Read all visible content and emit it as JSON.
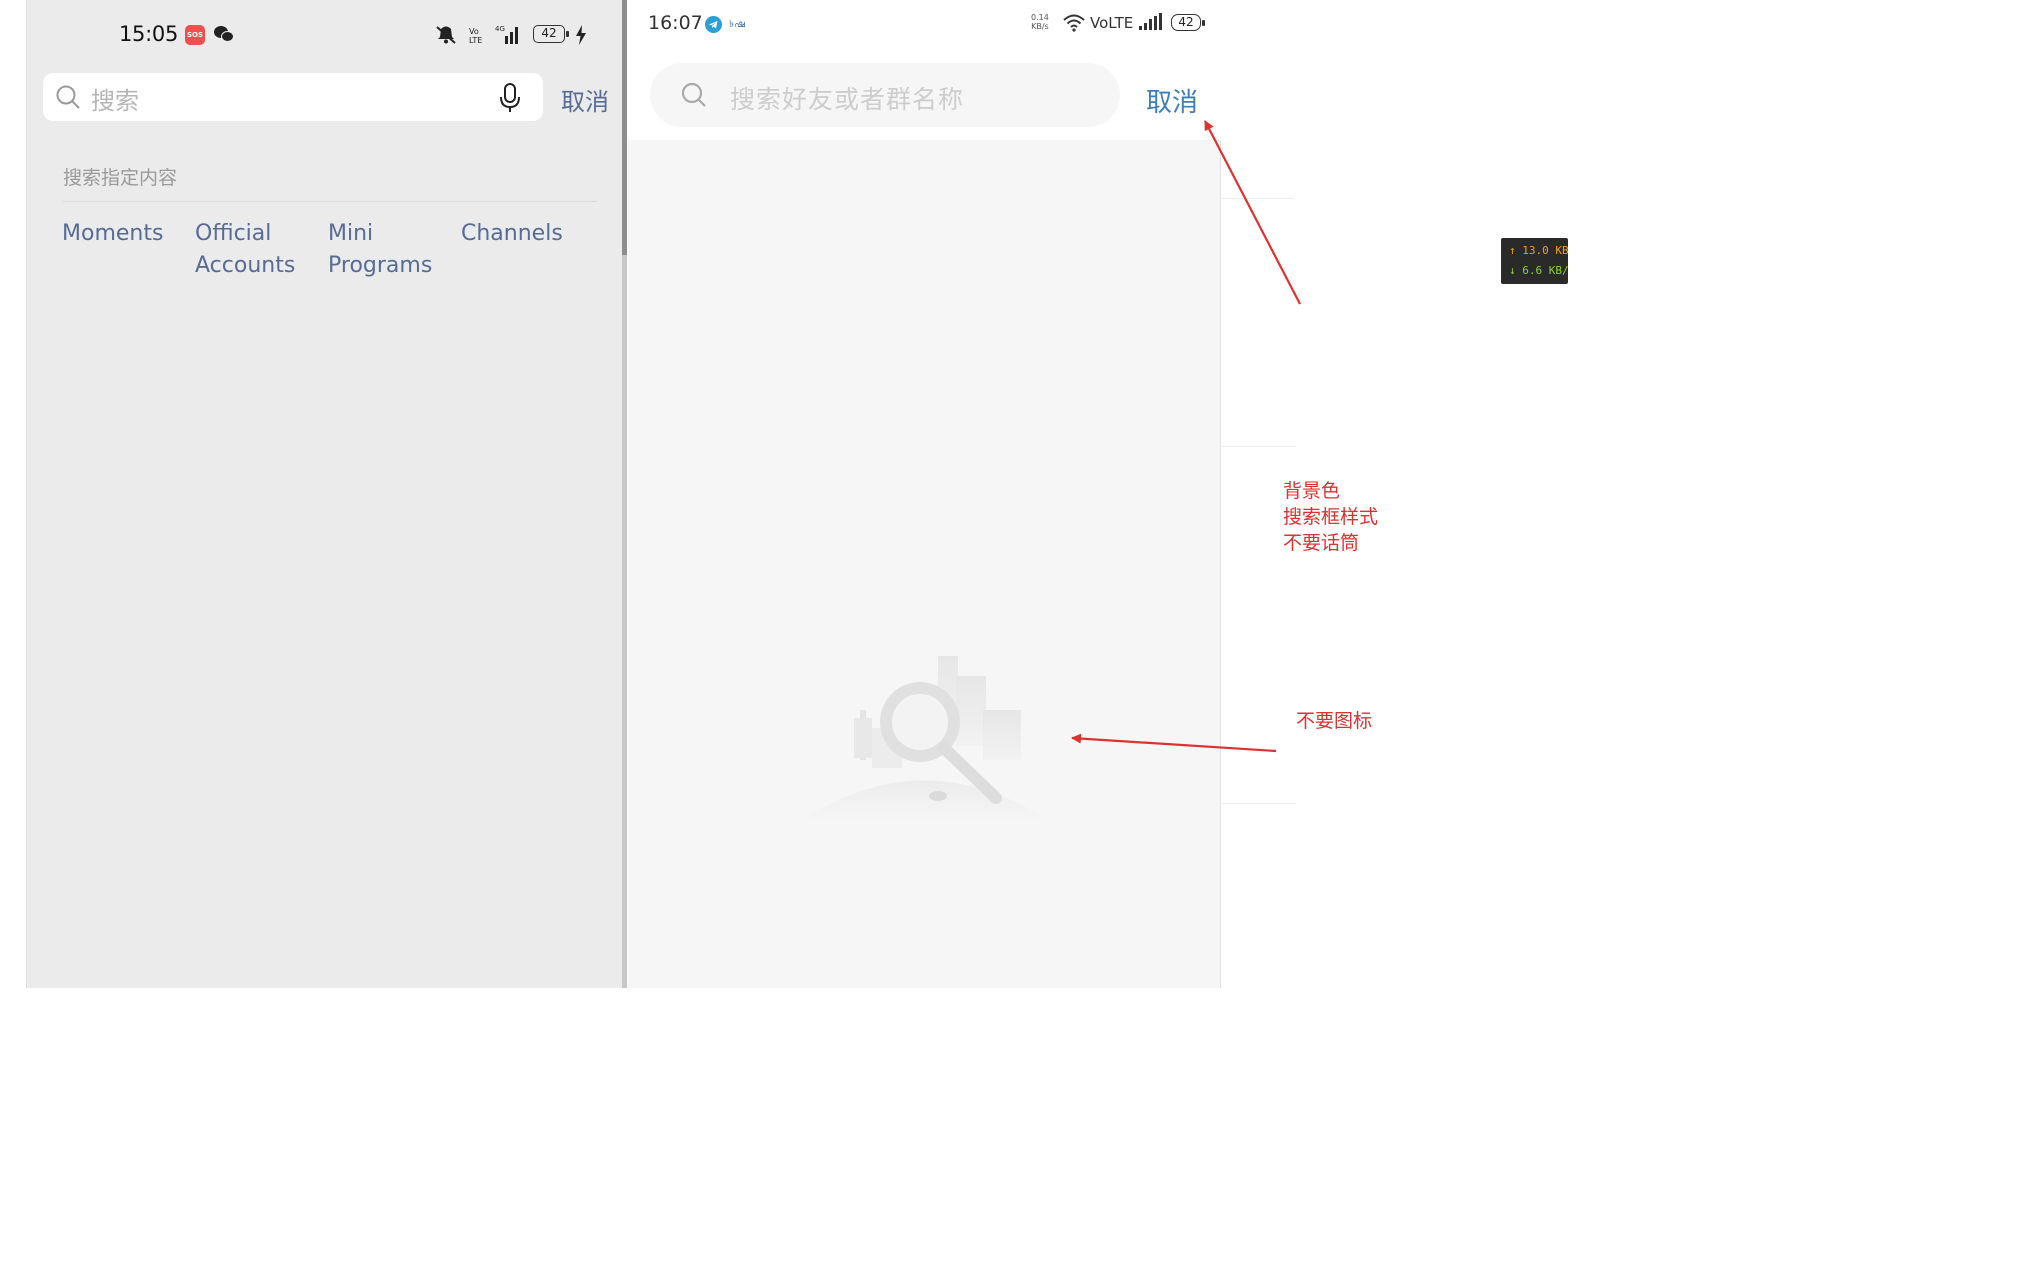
{
  "left_screen": {
    "status_bar": {
      "time": "15:05",
      "sos_badge": "SOS",
      "battery": "42"
    },
    "search": {
      "placeholder": "搜索",
      "cancel": "取消"
    },
    "section_title": "搜索指定内容",
    "filters": [
      {
        "label": "Moments"
      },
      {
        "label": "Official\nAccounts"
      },
      {
        "label": "Mini\nPrograms"
      },
      {
        "label": "Channels"
      }
    ]
  },
  "right_screen": {
    "status_bar": {
      "time": "16:07",
      "app_text": "৳ഷ",
      "net_speed": "0.14\nKB/s",
      "volte": "VoLTE",
      "battery": "42"
    },
    "search": {
      "placeholder": "搜索好友或者群名称",
      "cancel": "取消"
    }
  },
  "annotations": {
    "note_1": "背景色\n搜索框样式\n不要话筒",
    "note_2": "不要图标",
    "color": "#e03030"
  },
  "net_monitor": {
    "up": "↑ 13.0 KB",
    "down": "↓ 6.6 KB/"
  },
  "colors": {
    "link_blue_left": "#576b95",
    "link_blue_right": "#3e7dc0",
    "left_bg": "#ebebeb",
    "right_bg": "#f6f6f6"
  }
}
